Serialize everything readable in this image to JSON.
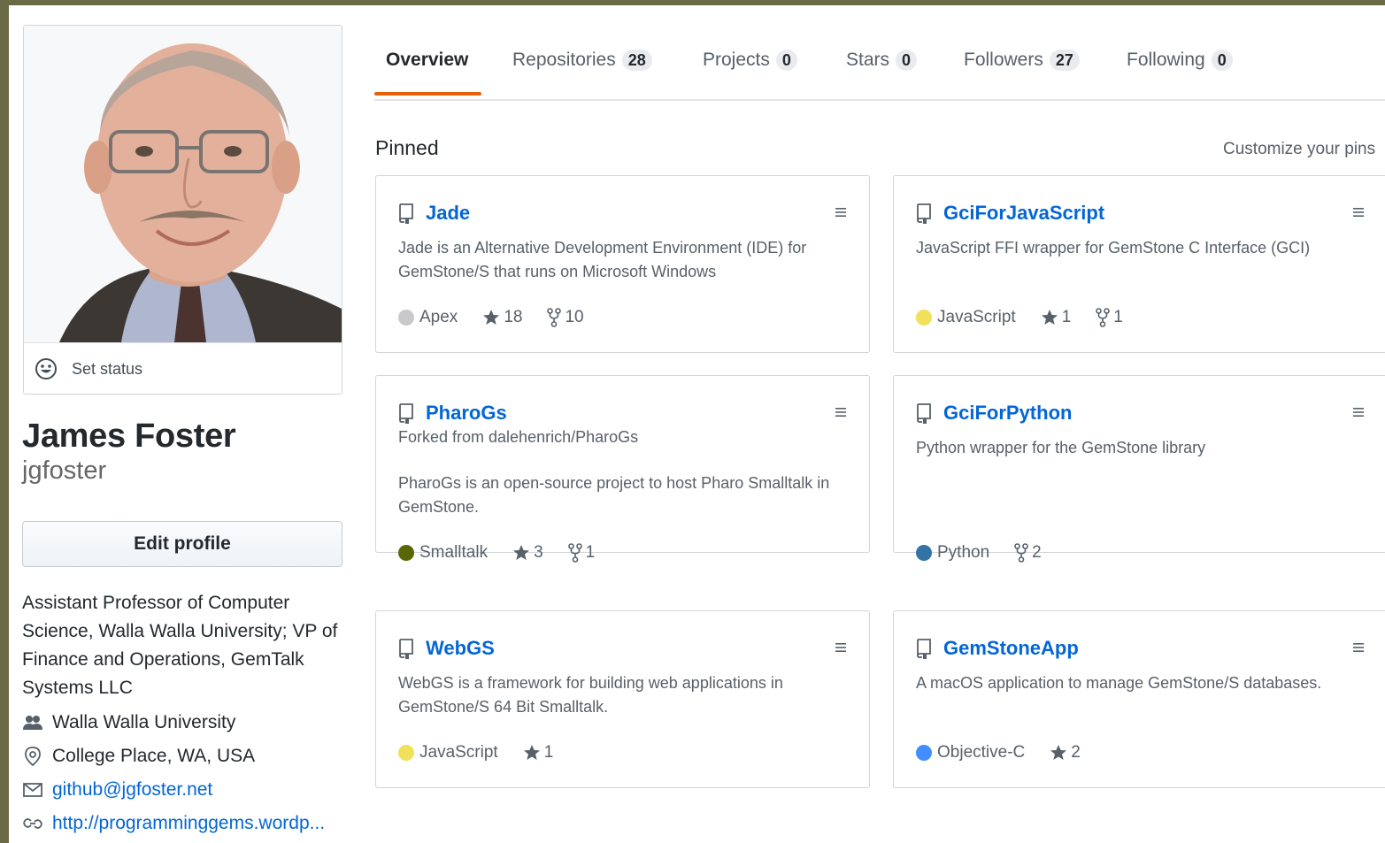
{
  "profile": {
    "set_status": "Set status",
    "full_name": "James Foster",
    "username": "jgfoster",
    "edit_profile": "Edit profile",
    "bio": "Assistant Professor of Computer Science, Walla Walla University; VP of Finance and Operations, GemTalk Systems LLC",
    "company": "Walla Walla University",
    "location": "College Place, WA, USA",
    "email": "github@jgfoster.net",
    "website": "http://programminggems.wordp..."
  },
  "tabs": [
    {
      "label": "Overview",
      "count": null,
      "selected": true
    },
    {
      "label": "Repositories",
      "count": "28"
    },
    {
      "label": "Projects",
      "count": "0"
    },
    {
      "label": "Stars",
      "count": "0"
    },
    {
      "label": "Followers",
      "count": "27"
    },
    {
      "label": "Following",
      "count": "0"
    }
  ],
  "pinned": {
    "title": "Pinned",
    "customize": "Customize your pins",
    "repos": [
      {
        "name": "Jade",
        "forked_from": "",
        "description": "Jade is an Alternative Development Environment (IDE) for GemStone/S that runs on Microsoft Windows",
        "language": "Apex",
        "language_color": "#c9c9cc",
        "stars": "18",
        "forks": "10"
      },
      {
        "name": "GciForJavaScript",
        "forked_from": "",
        "description": "JavaScript FFI wrapper for GemStone C Interface (GCI)",
        "language": "JavaScript",
        "language_color": "#f1e05a",
        "stars": "1",
        "forks": "1"
      },
      {
        "name": "PharoGs",
        "forked_from": "Forked from dalehenrich/PharoGs",
        "description": "PharoGs is an open-source project to host Pharo Smalltalk in GemStone.",
        "language": "Smalltalk",
        "language_color": "#596706",
        "stars": "3",
        "forks": "1"
      },
      {
        "name": "GciForPython",
        "forked_from": "",
        "description": "Python wrapper for the GemStone library",
        "language": "Python",
        "language_color": "#3572A5",
        "stars": "",
        "forks": "2"
      },
      {
        "name": "WebGS",
        "forked_from": "",
        "description": "WebGS is a framework for building web applications in GemStone/S 64 Bit Smalltalk.",
        "language": "JavaScript",
        "language_color": "#f1e05a",
        "stars": "1",
        "forks": ""
      },
      {
        "name": "GemStoneApp",
        "forked_from": "",
        "description": "A macOS application to manage GemStone/S databases.",
        "language": "Objective-C",
        "language_color": "#438eff",
        "stars": "2",
        "forks": ""
      }
    ]
  },
  "colors": {
    "accent": "#e36209",
    "link": "#0366d6",
    "muted": "#586069"
  }
}
